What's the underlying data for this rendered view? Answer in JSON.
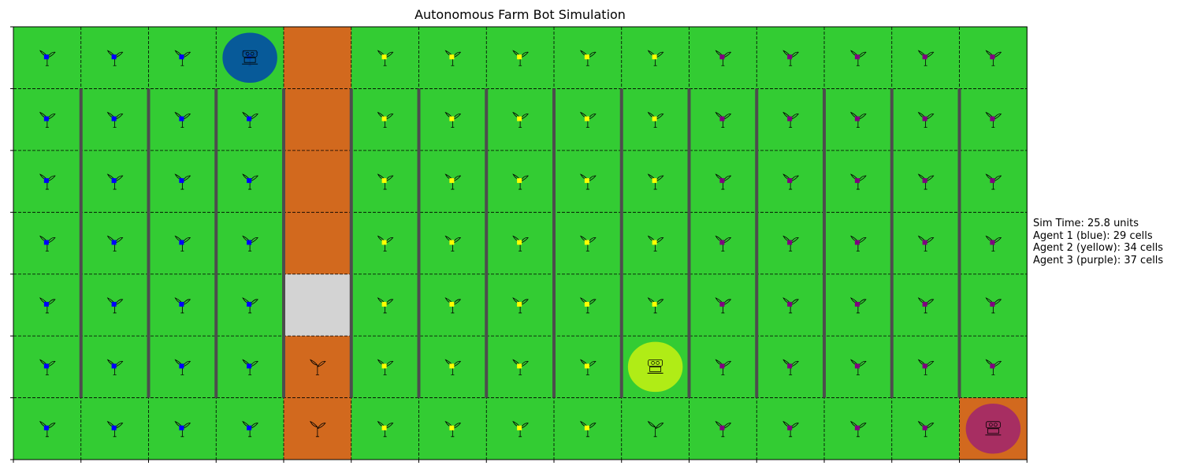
{
  "title": "Autonomous Farm Bot Simulation",
  "grid": {
    "rows": 7,
    "cols": 15,
    "cell_types": [
      "GGGGSGGGGGGGGGG",
      "GGGGSGGGGGGGGGG",
      "GGGGSGGGGGGGGGG",
      "GGGGSGGGGGGGGGG",
      "GGGGXGGGGGGGGGG",
      "GGGGSGGGGGGGGGG",
      "GGGGSGGGGGGGGGS"
    ],
    "markers": [
      "BBBB.YYYYYPPPPP",
      "BBBB.YYYYYPPPPP",
      "BBBB.YYYYYPPPPP",
      "BBBB.YYYYYPPPPP",
      "BBBB.YYYYYPPPPP",
      "BBBB.YYYY.PPPPP",
      "BBBB.YYYY.PPPP."
    ],
    "plants": [
      "111101111111111",
      "111101111111111",
      "111101111111111",
      "111101111111111",
      "111101111111111",
      "111111111011111",
      "111111111111110"
    ]
  },
  "colors": {
    "grass": "#33cc33",
    "soil": "#d2691e",
    "blocked": "#d3d3d3",
    "fence": "#4d4d4d",
    "marker_blue": "#0000ff",
    "marker_yellow": "#ffff00",
    "marker_purple": "#800080"
  },
  "agents": [
    {
      "name": "Agent 1",
      "color_name": "blue",
      "fill": "#0047ab",
      "row": 0,
      "col": 3
    },
    {
      "name": "Agent 2",
      "color_name": "yellow",
      "fill": "#c6f211",
      "row": 5,
      "col": 9
    },
    {
      "name": "Agent 3",
      "color_name": "purple",
      "fill": "#a0246e",
      "row": 6,
      "col": 14
    }
  ],
  "info": {
    "sim_time": "Sim Time: 25.8 units",
    "agent1": "Agent 1 (blue): 29 cells",
    "agent2": "Agent 2 (yellow): 34 cells",
    "agent3": "Agent 3 (purple): 37 cells"
  }
}
